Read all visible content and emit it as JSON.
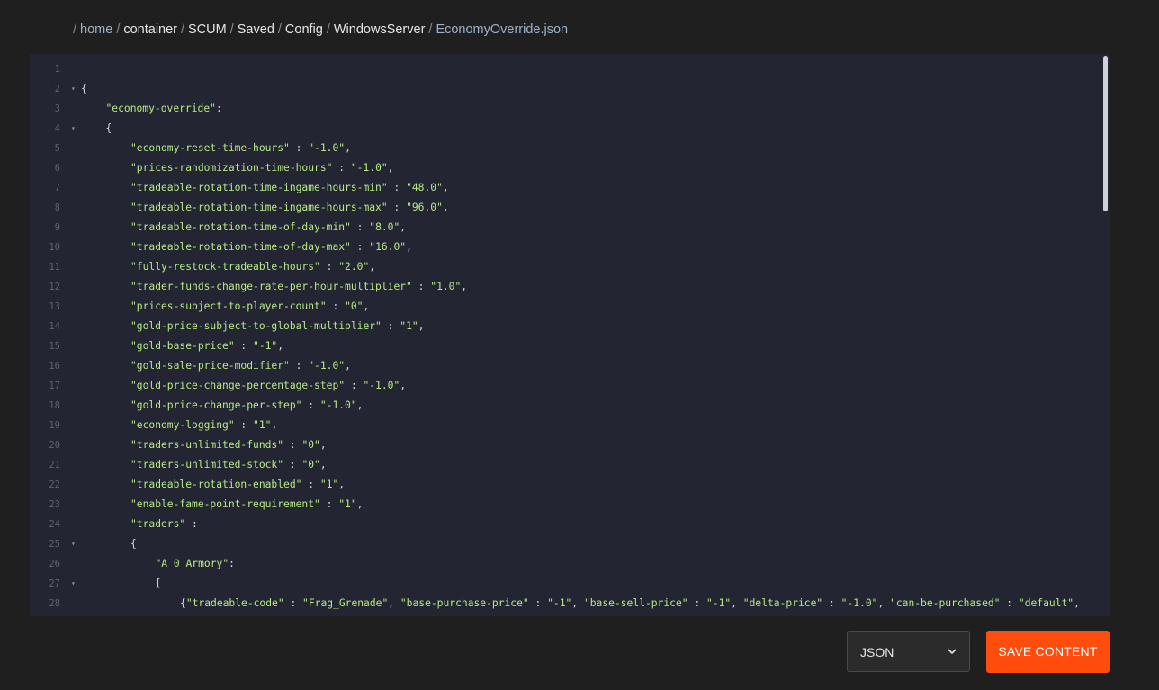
{
  "breadcrumb": {
    "segments": [
      "home",
      "container",
      "SCUM",
      "Saved",
      "Config",
      "WindowsServer",
      "EconomyOverride.json"
    ]
  },
  "editor": {
    "lines": [
      {
        "n": "1",
        "fold": false,
        "indent": 0,
        "code": ""
      },
      {
        "n": "2",
        "fold": true,
        "indent": 0,
        "code": "{"
      },
      {
        "n": "3",
        "fold": false,
        "indent": 1,
        "code": "\"economy-override\":"
      },
      {
        "n": "4",
        "fold": true,
        "indent": 1,
        "code": "{"
      },
      {
        "n": "5",
        "fold": false,
        "indent": 2,
        "code": "\"economy-reset-time-hours\" : \"-1.0\","
      },
      {
        "n": "6",
        "fold": false,
        "indent": 2,
        "code": "\"prices-randomization-time-hours\" : \"-1.0\","
      },
      {
        "n": "7",
        "fold": false,
        "indent": 2,
        "code": "\"tradeable-rotation-time-ingame-hours-min\" : \"48.0\","
      },
      {
        "n": "8",
        "fold": false,
        "indent": 2,
        "code": "\"tradeable-rotation-time-ingame-hours-max\" : \"96.0\","
      },
      {
        "n": "9",
        "fold": false,
        "indent": 2,
        "code": "\"tradeable-rotation-time-of-day-min\" : \"8.0\","
      },
      {
        "n": "10",
        "fold": false,
        "indent": 2,
        "code": "\"tradeable-rotation-time-of-day-max\" : \"16.0\","
      },
      {
        "n": "11",
        "fold": false,
        "indent": 2,
        "code": "\"fully-restock-tradeable-hours\" : \"2.0\","
      },
      {
        "n": "12",
        "fold": false,
        "indent": 2,
        "code": "\"trader-funds-change-rate-per-hour-multiplier\" : \"1.0\","
      },
      {
        "n": "13",
        "fold": false,
        "indent": 2,
        "code": "\"prices-subject-to-player-count\" : \"0\","
      },
      {
        "n": "14",
        "fold": false,
        "indent": 2,
        "code": "\"gold-price-subject-to-global-multiplier\" : \"1\","
      },
      {
        "n": "15",
        "fold": false,
        "indent": 2,
        "code": "\"gold-base-price\" : \"-1\","
      },
      {
        "n": "16",
        "fold": false,
        "indent": 2,
        "code": "\"gold-sale-price-modifier\" : \"-1.0\","
      },
      {
        "n": "17",
        "fold": false,
        "indent": 2,
        "code": "\"gold-price-change-percentage-step\" : \"-1.0\","
      },
      {
        "n": "18",
        "fold": false,
        "indent": 2,
        "code": "\"gold-price-change-per-step\" : \"-1.0\","
      },
      {
        "n": "19",
        "fold": false,
        "indent": 2,
        "code": "\"economy-logging\" : \"1\","
      },
      {
        "n": "20",
        "fold": false,
        "indent": 2,
        "code": "\"traders-unlimited-funds\" : \"0\","
      },
      {
        "n": "21",
        "fold": false,
        "indent": 2,
        "code": "\"traders-unlimited-stock\" : \"0\","
      },
      {
        "n": "22",
        "fold": false,
        "indent": 2,
        "code": "\"tradeable-rotation-enabled\" : \"1\","
      },
      {
        "n": "23",
        "fold": false,
        "indent": 2,
        "code": "\"enable-fame-point-requirement\" : \"1\","
      },
      {
        "n": "24",
        "fold": false,
        "indent": 2,
        "code": "\"traders\" :"
      },
      {
        "n": "25",
        "fold": true,
        "indent": 2,
        "code": "{"
      },
      {
        "n": "26",
        "fold": false,
        "indent": 3,
        "code": "\"A_0_Armory\":"
      },
      {
        "n": "27",
        "fold": true,
        "indent": 3,
        "code": "["
      },
      {
        "n": "28",
        "fold": false,
        "indent": 4,
        "code": "{\"tradeable-code\" : \"Frag_Grenade\", \"base-purchase-price\" : \"-1\", \"base-sell-price\" : \"-1\", \"delta-price\" : \"-1.0\", \"can-be-purchased\" : \"default\","
      }
    ]
  },
  "controls": {
    "language_value": "JSON",
    "save_label": "SAVE CONTENT"
  },
  "colors": {
    "accent": "#ff4d0d",
    "editor_bg": "#232632",
    "string": "#b8e986"
  }
}
